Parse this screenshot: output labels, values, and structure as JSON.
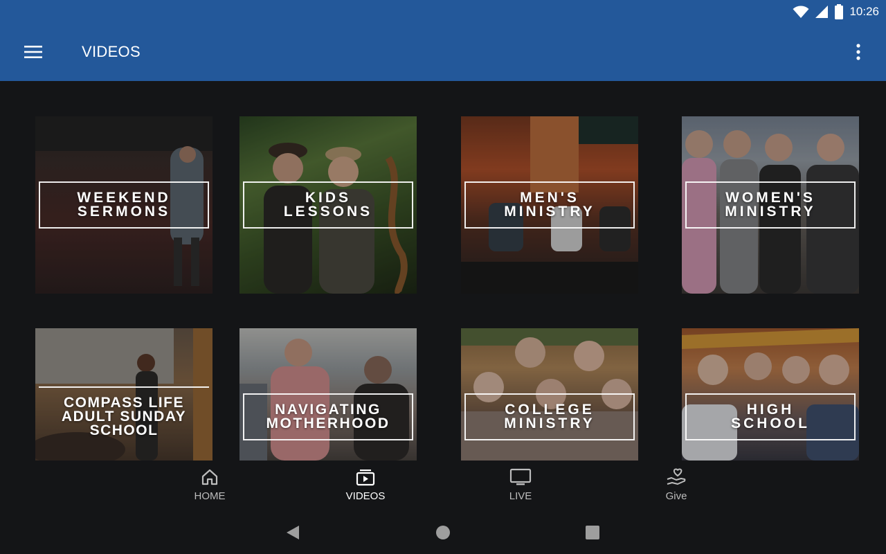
{
  "status_bar": {
    "time": "10:26",
    "icons": [
      "wifi-icon",
      "signal-icon",
      "battery-icon"
    ]
  },
  "app_bar": {
    "menu_icon": "hamburger-menu-icon",
    "title": "VIDEOS",
    "more_icon": "more-vertical-icon",
    "background": "#23589a"
  },
  "tiles": [
    {
      "label": "WEEKEND\nSERMONS"
    },
    {
      "label": "KIDS\nLESSONS"
    },
    {
      "label": "MEN'S\nMINISTRY"
    },
    {
      "label": "WOMEN'S\nMINISTRY"
    },
    {
      "label": "COMPASS LIFE\nADULT SUNDAY\nSCHOOL"
    },
    {
      "label": "NAVIGATING\nMOTHERHOOD"
    },
    {
      "label": "COLLEGE\nMINISTRY"
    },
    {
      "label": "HIGH\nSCHOOL"
    }
  ],
  "bottom_nav": {
    "items": [
      {
        "label": "HOME",
        "icon": "home-icon",
        "active": false
      },
      {
        "label": "VIDEOS",
        "icon": "video-library-icon",
        "active": true
      },
      {
        "label": "LIVE",
        "icon": "tv-icon",
        "active": false
      },
      {
        "label": "Give",
        "icon": "give-heart-hand-icon",
        "active": false
      }
    ]
  },
  "system_nav": {
    "icons": [
      "back-icon",
      "home-circle-icon",
      "recents-square-icon"
    ]
  }
}
